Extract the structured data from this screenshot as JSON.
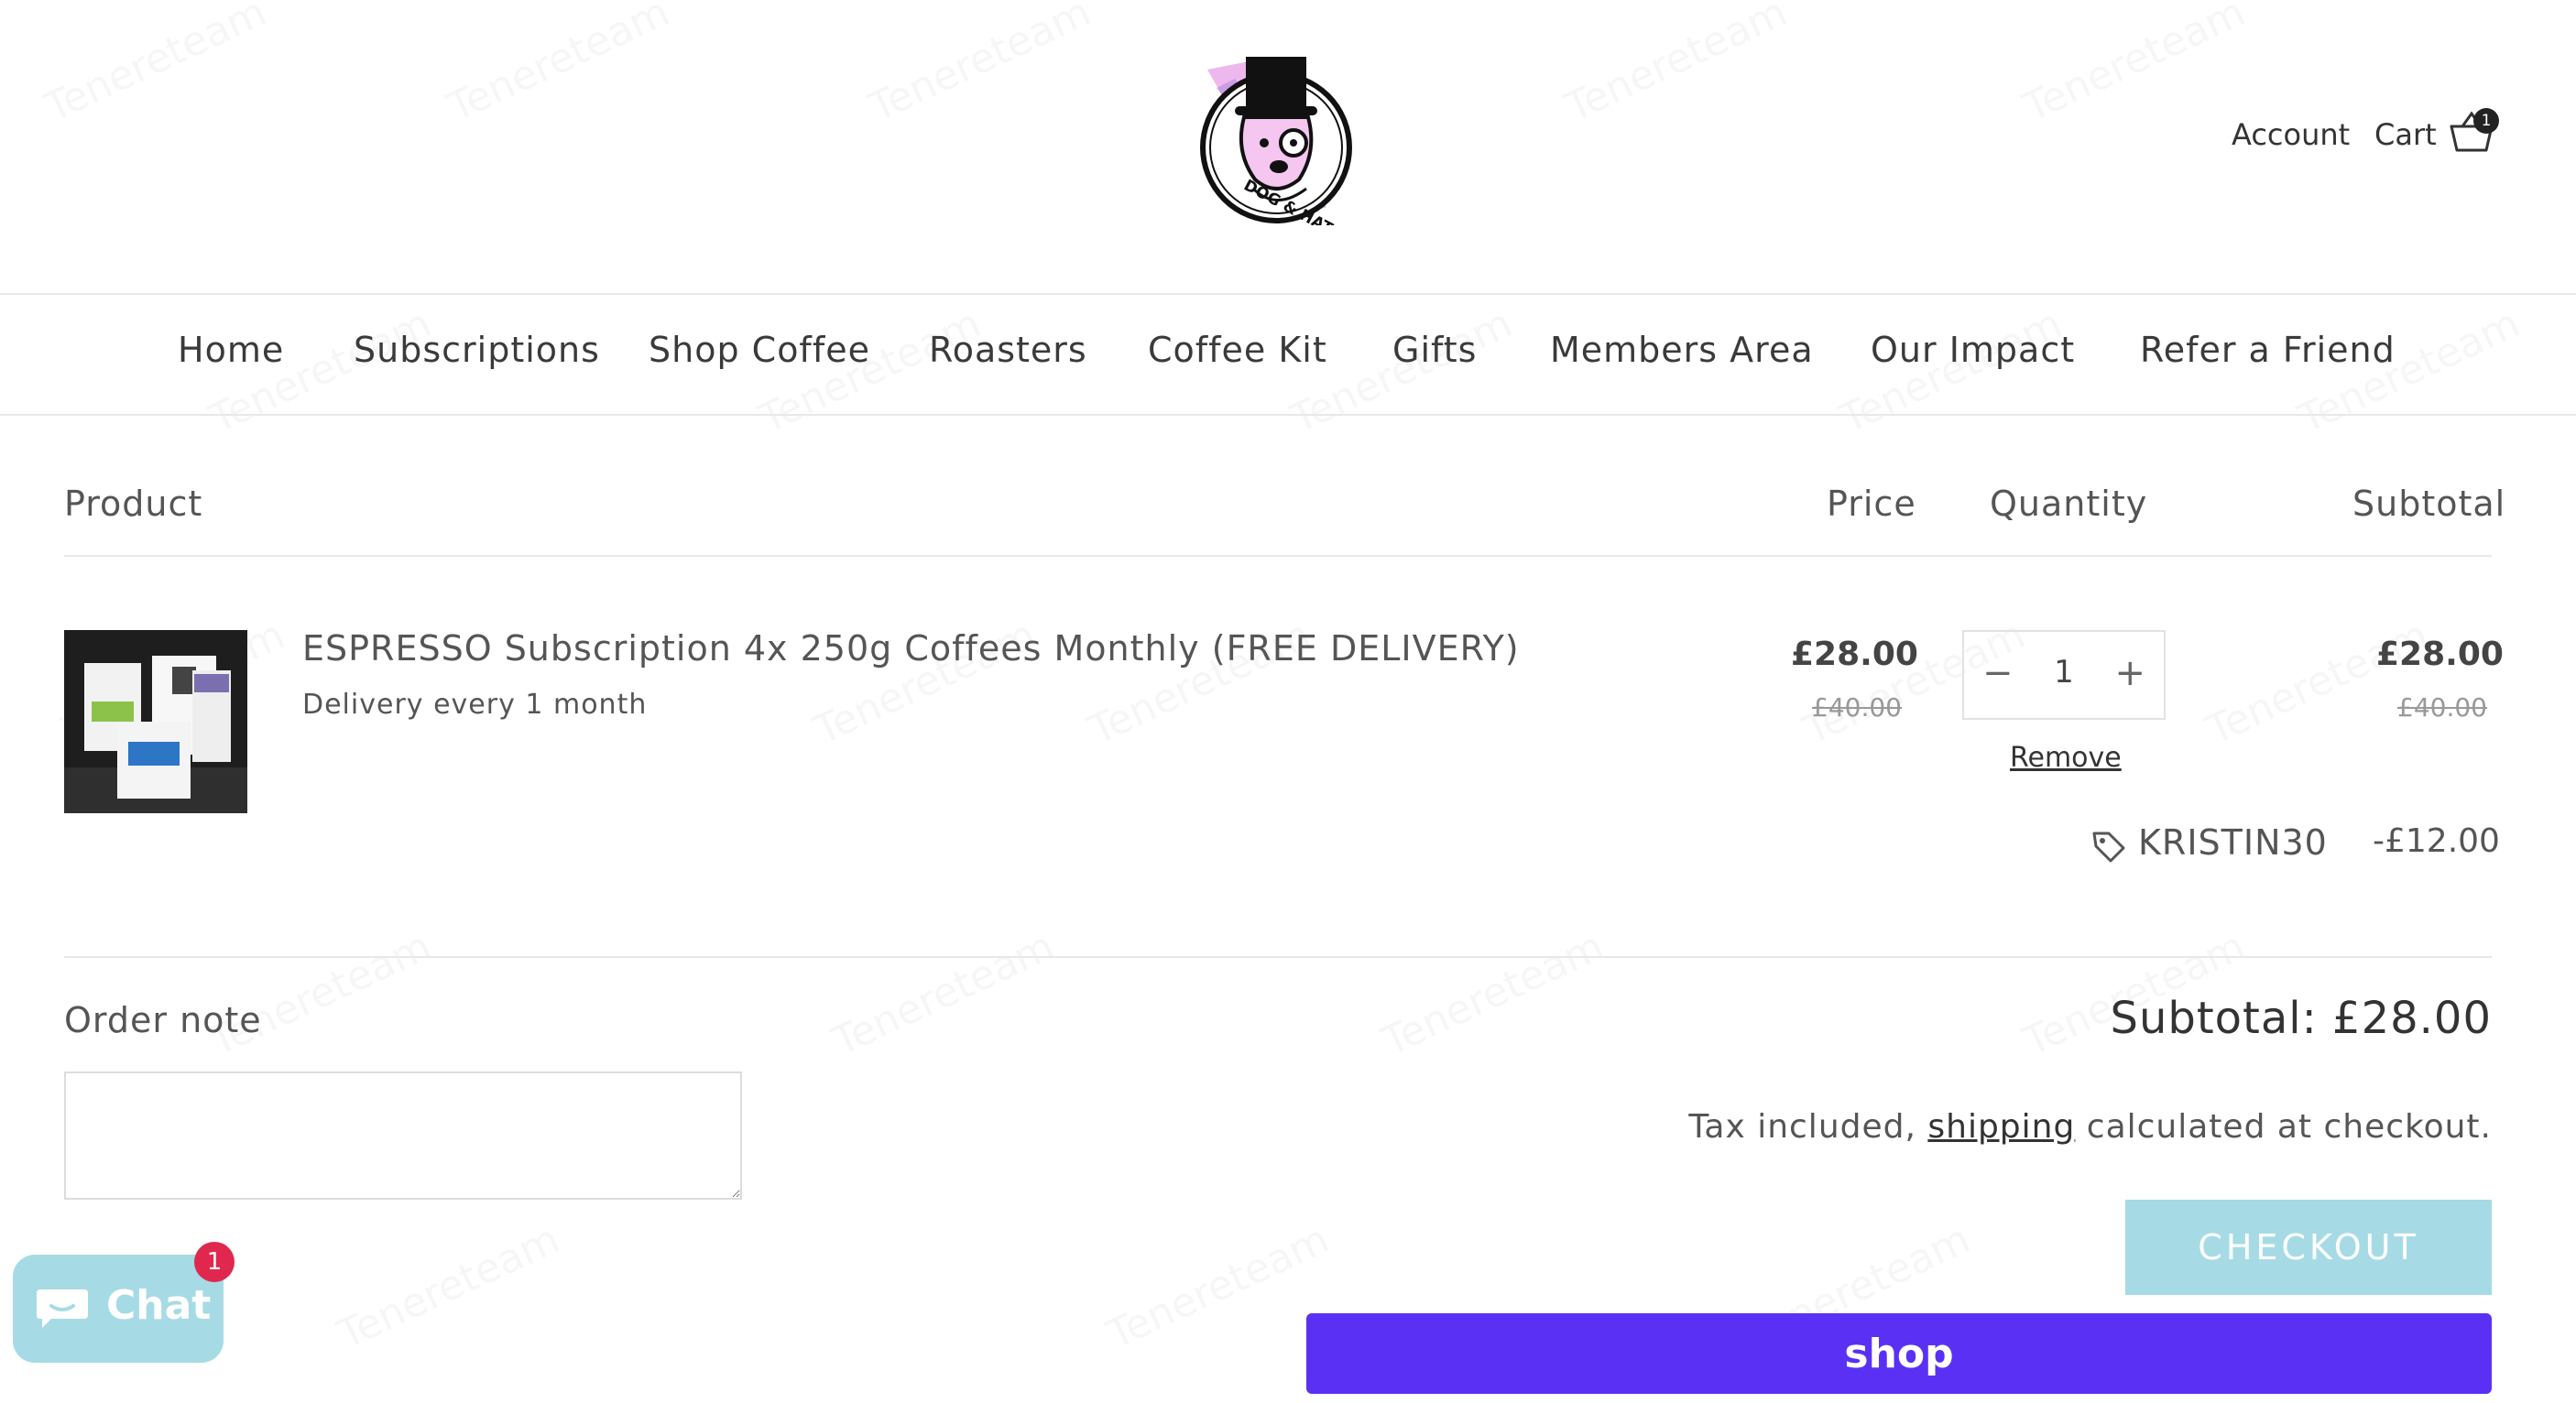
{
  "header": {
    "logo_text": "DOG & HAT",
    "account_label": "Account",
    "cart_label": "Cart",
    "cart_count": "1"
  },
  "nav": {
    "items": [
      {
        "label": "Home"
      },
      {
        "label": "Subscriptions"
      },
      {
        "label": "Shop Coffee"
      },
      {
        "label": "Roasters"
      },
      {
        "label": "Coffee Kit"
      },
      {
        "label": "Gifts"
      },
      {
        "label": "Members Area"
      },
      {
        "label": "Our Impact"
      },
      {
        "label": "Refer a Friend"
      }
    ]
  },
  "table": {
    "headers": {
      "product": "Product",
      "price": "Price",
      "quantity": "Quantity",
      "subtotal": "Subtotal"
    }
  },
  "line_item": {
    "title": "ESPRESSO Subscription 4x 250g Coffees Monthly (FREE DELIVERY)",
    "subtitle": "Delivery every 1 month",
    "price": "£28.00",
    "compare_price": "£40.00",
    "quantity": "1",
    "subtotal": "£28.00",
    "compare_subtotal": "£40.00",
    "remove_label": "Remove",
    "discount_code": "KRISTIN30",
    "discount_amount": "-£12.00"
  },
  "order_note": {
    "label": "Order note",
    "value": ""
  },
  "summary": {
    "subtotal": "Subtotal: £28.00",
    "tax_before": "Tax included, ",
    "tax_link": "shipping",
    "tax_after": " calculated at checkout.",
    "checkout_label": "CHECKOUT",
    "shop_label": "shop"
  },
  "chat": {
    "label": "Chat",
    "badge": "1"
  },
  "colors": {
    "checkout": "#a6dbe6",
    "shop_pay": "#5a31f4",
    "chat": "#a6dbe6",
    "badge": "#e0284f"
  }
}
